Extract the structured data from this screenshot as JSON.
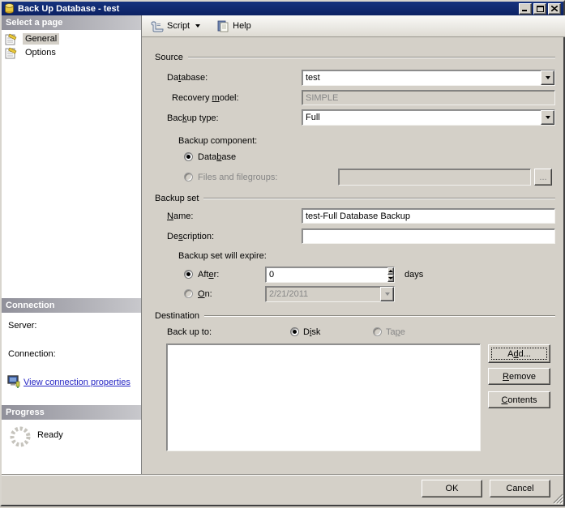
{
  "colors": {
    "titlebar": "#0e2a6d",
    "face": "#d4d0c8",
    "sidebar_bg": "#ffffff",
    "header_gradient_dark": "#90909a",
    "header_gradient_light": "#c8c8cc",
    "link": "#2525c4",
    "disabled_text": "#878787",
    "db_icon_yellow": "#e8c83c"
  },
  "window": {
    "title": "Back Up Database - test"
  },
  "toolbar": {
    "script_label": "Script",
    "help_label": "Help"
  },
  "sidebar": {
    "pages_header": "Select a page",
    "pages": [
      {
        "label": "General",
        "selected": true
      },
      {
        "label": "Options",
        "selected": false
      }
    ],
    "connection_header": "Connection",
    "server_label": "Server:",
    "server_value": "",
    "connection_label": "Connection:",
    "connection_value": "",
    "link_label": "View connection properties",
    "progress_header": "Progress",
    "status": "Ready"
  },
  "source": {
    "title": "Source",
    "database_label": "Database:",
    "database_value": "test",
    "recovery_label": "Recovery model:",
    "recovery_value": "SIMPLE",
    "backup_type_label": "Backup type:",
    "backup_type_value": "Full",
    "component_label": "Backup component:",
    "database_radio_label": "Database",
    "files_radio_label": "Files and filegroups:",
    "files_value": "",
    "browse_label": "..."
  },
  "backup_set": {
    "title": "Backup set",
    "name_label": "Name:",
    "name_value": "test-Full Database Backup",
    "description_label": "Description:",
    "description_value": "",
    "expire_label": "Backup set will expire:",
    "after_label": "After:",
    "after_value": "0",
    "after_unit": "days",
    "on_label": "On:",
    "on_value": "2/21/2011"
  },
  "destination": {
    "title": "Destination",
    "backup_to_label": "Back up to:",
    "disk_label": "Disk",
    "tape_label": "Tape",
    "items": [],
    "add_label": "Add...",
    "remove_label": "Remove",
    "contents_label": "Contents"
  },
  "footer": {
    "ok_label": "OK",
    "cancel_label": "Cancel"
  }
}
